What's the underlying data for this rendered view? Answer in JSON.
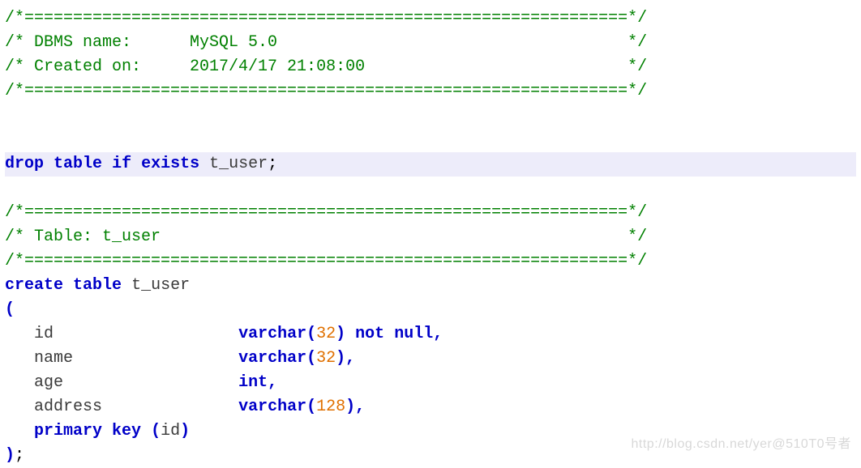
{
  "header": {
    "border_top": "/*==============================================================*/",
    "dbms_line": "/* DBMS name:      MySQL 5.0                                    */",
    "created_line": "/* Created on:     2017/4/17 21:08:00                           */",
    "border_bottom": "/*==============================================================*/"
  },
  "drop_stmt": {
    "kw_drop": "drop",
    "kw_table": "table",
    "kw_if": "if",
    "kw_exists": "exists",
    "table_name": "t_user",
    "semi": ";"
  },
  "table_header": {
    "border_top": "/*==============================================================*/",
    "table_line": "/* Table: t_user                                                */",
    "border_bottom": "/*==============================================================*/"
  },
  "create_stmt": {
    "kw_create": "create",
    "kw_table": "table",
    "table_name": "t_user",
    "open_paren": "(",
    "columns": {
      "id": {
        "name": "id",
        "pad": "                   ",
        "type": "varchar",
        "open": "(",
        "size": "32",
        "close": ")",
        "kw_not": "not",
        "kw_null": "null",
        "comma": ","
      },
      "name": {
        "name": "name",
        "pad": "                 ",
        "type": "varchar",
        "open": "(",
        "size": "32",
        "close": ")",
        "comma": ","
      },
      "age": {
        "name": "age",
        "pad": "                  ",
        "type": "int",
        "comma": ","
      },
      "address": {
        "name": "address",
        "pad": "              ",
        "type": "varchar",
        "open": "(",
        "size": "128",
        "close": ")",
        "comma": ","
      }
    },
    "pk": {
      "kw_primary": "primary",
      "kw_key": "key",
      "open": "(",
      "col": "id",
      "close": ")"
    },
    "close_paren": ")",
    "semi": ";"
  },
  "watermark": "http://blog.csdn.net/yer@510T0号者"
}
